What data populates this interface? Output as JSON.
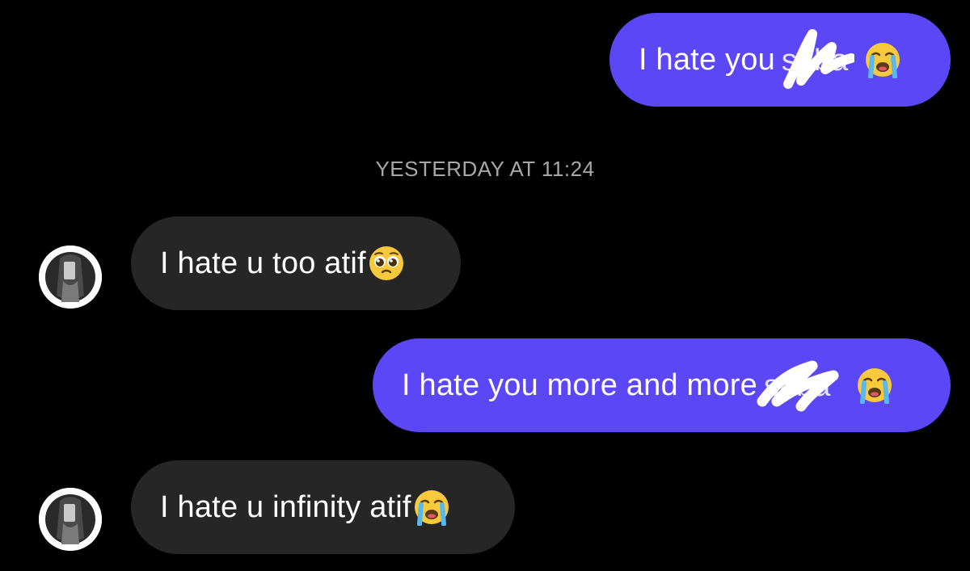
{
  "conversation": {
    "messages": [
      {
        "direction": "sent",
        "text": "I hate you",
        "redacted_text": "saba",
        "emoji": "loudly-crying-face"
      },
      {
        "direction": "received",
        "text": "I hate u too atif",
        "emoji": "pleading-face"
      },
      {
        "direction": "sent",
        "text": "I hate you more and more",
        "redacted_text": "saba",
        "emoji": "loudly-crying-face"
      },
      {
        "direction": "received",
        "text": "I hate u infinity atif",
        "emoji": "loudly-crying-face"
      }
    ],
    "timestamp": "YESTERDAY AT 11:24"
  },
  "colors": {
    "background": "#000000",
    "sent_bubble": "#5b47f5",
    "received_bubble": "#262626",
    "timestamp_text": "#a8a8a8"
  }
}
